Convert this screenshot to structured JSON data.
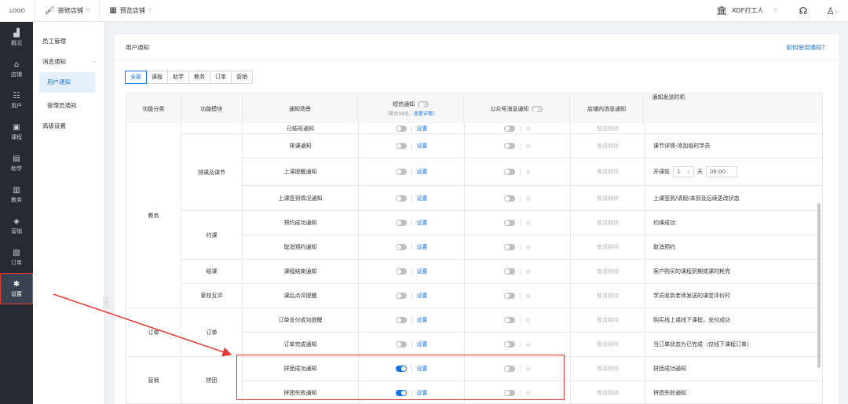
{
  "topbar": {
    "logo": "LOGO",
    "shop_decor": "装修店铺",
    "preview_shop": "预览店铺",
    "store_name": "XDF打工人"
  },
  "leftnav": [
    {
      "label": "概况",
      "icon": "chart-icon"
    },
    {
      "label": "店铺",
      "icon": "shop-icon"
    },
    {
      "label": "用户",
      "icon": "users-icon"
    },
    {
      "label": "课程",
      "icon": "course-icon"
    },
    {
      "label": "助学",
      "icon": "assist-icon"
    },
    {
      "label": "教务",
      "icon": "academic-icon"
    },
    {
      "label": "营销",
      "icon": "marketing-icon"
    },
    {
      "label": "订单",
      "icon": "order-icon"
    },
    {
      "label": "设置",
      "icon": "gear-icon",
      "active": true
    }
  ],
  "subnav": {
    "staff": "员工管理",
    "message_notice": "消息通知",
    "user_notice": "用户通知",
    "admin_notice": "管理员通知",
    "advanced": "高级设置"
  },
  "main": {
    "title": "用户通知",
    "help_link": "如何使用通知？",
    "tabs": [
      "全部",
      "课程",
      "助学",
      "教务",
      "订单",
      "营销"
    ],
    "headers": {
      "category": "功能分类",
      "module": "功能模块",
      "scene": "通知场景",
      "sms": "短信通知",
      "sms_remaining": "（剩余98条，",
      "sms_detail": "查看详情）",
      "wechat": "公众号消息通知",
      "instore": "店铺内消息通知",
      "send_time": "通知发送时机"
    },
    "rows": [
      {
        "scene": "已结班通知",
        "sms_on": false,
        "time": ""
      },
      {
        "scene": "排课通知",
        "sms_on": false,
        "time": "课节详情-添加临时学员"
      },
      {
        "scene": "上课提醒通知",
        "sms_on": false,
        "time_prefix": "开课前",
        "time_num": "1",
        "time_unit": "天",
        "time_clock": "08:00"
      },
      {
        "scene": "上课签到情况通知",
        "sms_on": false,
        "time": "上课签到/请假/未到及后续更改状态"
      },
      {
        "scene": "预约成功通知",
        "sms_on": false,
        "time": "约课成功"
      },
      {
        "scene": "取消预约通知",
        "sms_on": false,
        "time": "取消预约"
      },
      {
        "scene": "课程结束通知",
        "sms_on": false,
        "time": "客户购买的课程到期或课时耗完"
      },
      {
        "scene": "课后点评提醒",
        "sms_on": false,
        "time": "学员收到老师发送的课堂评价时"
      },
      {
        "scene": "订单支付成功提醒",
        "sms_on": false,
        "time": "购买线上或线下课程，支付成功"
      },
      {
        "scene": "订单完成通知",
        "sms_on": false,
        "time": "当订单状态为已完成（仅线下课程订单）"
      },
      {
        "scene": "拼团成功通知",
        "sms_on": true,
        "time": "拼团成功通知"
      },
      {
        "scene": "拼团失败通知",
        "sms_on": true,
        "time": "拼团失败通知"
      }
    ],
    "set_label": "设置",
    "instore_value": "敬请期待",
    "categories": {
      "jiaowu": "教务",
      "order": "订单",
      "marketing": "营销"
    },
    "modules": {
      "paike": "排课及课节",
      "yueke": "约课",
      "jieke": "结课",
      "jiaxiao": "家校互评",
      "order": "订单",
      "pintuan": "拼团"
    }
  },
  "colors": {
    "accent": "#1a73e8",
    "highlight": "#e53935",
    "nav_bg": "#262b33"
  }
}
